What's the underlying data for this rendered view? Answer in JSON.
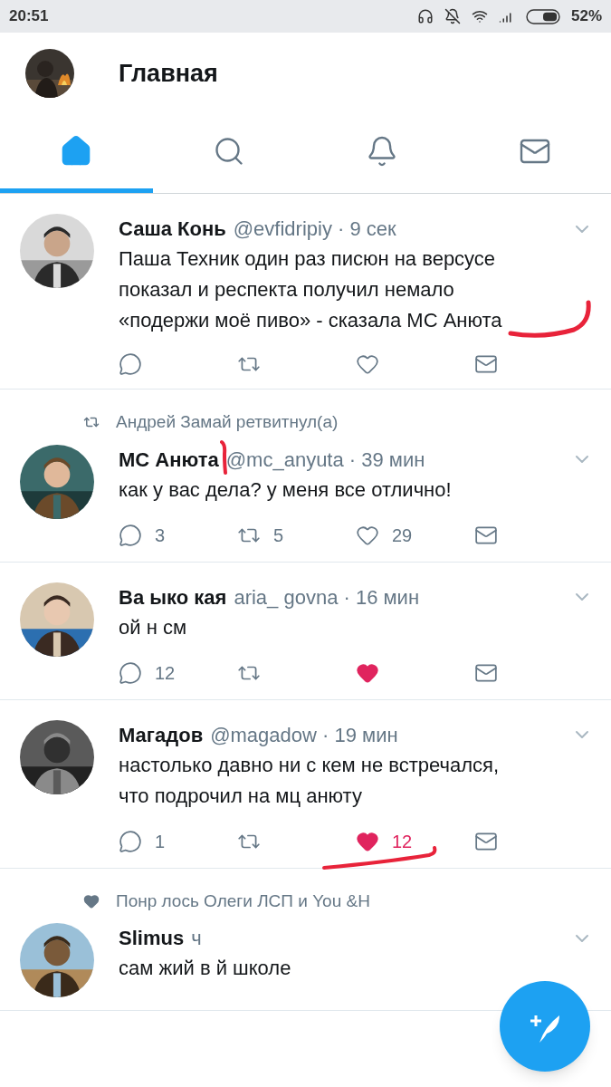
{
  "status_bar": {
    "time": "20:51",
    "battery": "52%"
  },
  "header": {
    "title": "Главная"
  },
  "tabs": [
    {
      "kind": "home",
      "selected": true
    },
    {
      "kind": "search",
      "selected": false
    },
    {
      "kind": "notifications",
      "selected": false
    },
    {
      "kind": "messages",
      "selected": false
    }
  ],
  "tweets": [
    {
      "avatar": {
        "kind": "picture"
      },
      "name": "Саша Конь",
      "meta": "@evfidripiy · 9 сек",
      "text_lines": [
        "Паша Техник один раз писюн на версусе",
        "показал и респекта получил немало",
        "«подержи моё пиво» - сказала МС Анюта"
      ],
      "liked": false,
      "actions": [
        {
          "kind": "reply"
        },
        {
          "kind": "retweet"
        },
        {
          "kind": "like"
        },
        {
          "kind": "message"
        }
      ]
    },
    {
      "context": {
        "kind": "retweet",
        "text": "Андрей Замай ретвитнул(а)"
      },
      "avatar": {
        "kind": "picture"
      },
      "name": "МС Анюта",
      "meta": "@mc_anyuta · 39 мин",
      "text_lines": [
        "как у вас дела? у меня все отлично!"
      ],
      "liked": false,
      "actions": [
        {
          "kind": "reply",
          "count": "3"
        },
        {
          "kind": "retweet",
          "count": "5"
        },
        {
          "kind": "like",
          "count": "29"
        },
        {
          "kind": "message"
        }
      ]
    },
    {
      "avatar": {
        "kind": "picture"
      },
      "name": "Ва ыко кая",
      "meta": "aria_ govna · 16 мин",
      "text_lines": [
        "ой н см"
      ],
      "liked": true,
      "actions": [
        {
          "kind": "reply",
          "count": "12"
        },
        {
          "kind": "retweet"
        },
        {
          "kind": "like"
        },
        {
          "kind": "message"
        }
      ]
    },
    {
      "avatar": {
        "kind": "picture"
      },
      "name": "Магадов",
      "meta": "@magadow · 19 мин",
      "text_lines": [
        "настолько давно ни с кем не встречался,",
        "что подрочил на мц анюту"
      ],
      "liked": true,
      "actions": [
        {
          "kind": "reply",
          "count": "1"
        },
        {
          "kind": "retweet"
        },
        {
          "kind": "like",
          "count": "12"
        },
        {
          "kind": "message"
        }
      ]
    },
    {
      "context": {
        "kind": "like",
        "text": "Понр лось Олеги ЛСП и You &H"
      },
      "avatar": {
        "kind": "picture"
      },
      "name": "Slimus",
      "meta": "ч",
      "text_lines": [
        "сам жий в й школе"
      ]
    }
  ],
  "fab": {
    "kind": "compose"
  }
}
